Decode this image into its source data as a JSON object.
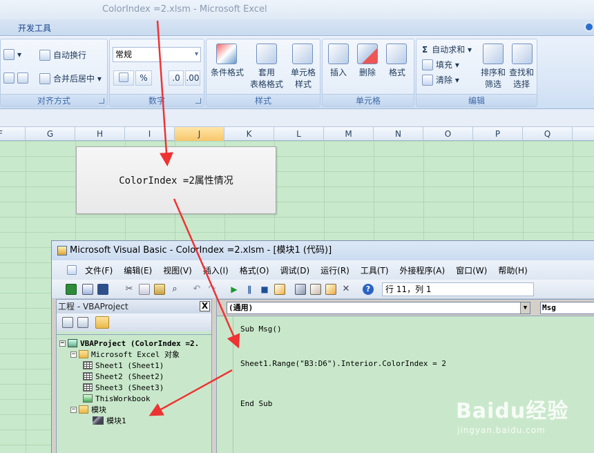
{
  "excel": {
    "title": "ColorIndex =2.xlsm - Microsoft Excel",
    "ribbon_tab": "开发工具",
    "groups": {
      "alignment": {
        "label": "对齐方式",
        "wrap_text": "自动换行",
        "merge_center": "合并后居中"
      },
      "number": {
        "label": "数字",
        "format_value": "常规",
        "percent": "%"
      },
      "styles": {
        "label": "样式",
        "conditional_format": "条件格式",
        "table_format_1": "套用",
        "table_format_2": "表格格式",
        "cell_style_1": "单元格",
        "cell_style_2": "样式"
      },
      "cells": {
        "label": "单元格",
        "insert": "插入",
        "delete": "删除",
        "format": "格式"
      },
      "editing": {
        "label": "编辑",
        "autosum": "自动求和",
        "fill": "填充",
        "clear": "清除",
        "sort_1": "排序和",
        "sort_2": "筛选",
        "find_1": "查找和",
        "find_2": "选择"
      }
    },
    "columns": [
      "F",
      "G",
      "H",
      "I",
      "J",
      "K",
      "L",
      "M",
      "N",
      "O",
      "P",
      "Q"
    ],
    "selected_column": "J"
  },
  "caption": "ColorIndex =2属性情况",
  "vba": {
    "title": "Microsoft Visual Basic - ColorIndex =2.xlsm - [模块1 (代码)]",
    "menu": [
      "文件(F)",
      "编辑(E)",
      "视图(V)",
      "插入(I)",
      "格式(O)",
      "调试(D)",
      "运行(R)",
      "工具(T)",
      "外接程序(A)",
      "窗口(W)",
      "帮助(H)"
    ],
    "cursor_position": "行 11，列 1",
    "project_pane": {
      "title": "工程 - VBAProject",
      "close": "X",
      "tree": {
        "root": "VBAProject (ColorIndex =2.",
        "excel_objects": "Microsoft Excel 对象",
        "sheets": [
          "Sheet1 (Sheet1)",
          "Sheet2 (Sheet2)",
          "Sheet3 (Sheet3)"
        ],
        "workbook": "ThisWorkbook",
        "modules": "模块",
        "module1": "模块1"
      }
    },
    "code_pane": {
      "object_combo": "(通用)",
      "proc_combo": "Msg",
      "lines": [
        "Sub Msg()",
        "Sheet1.Range(\"B3:D6\").Interior.ColorIndex = 2",
        "End Sub"
      ]
    }
  },
  "watermark": {
    "brand": "Baidu经验",
    "url": "jingyan.baidu.com"
  },
  "colors": {
    "arrow": "#ee3333",
    "sheet_bg": "#c8e9cb",
    "selected_col": "#f7c66c"
  }
}
